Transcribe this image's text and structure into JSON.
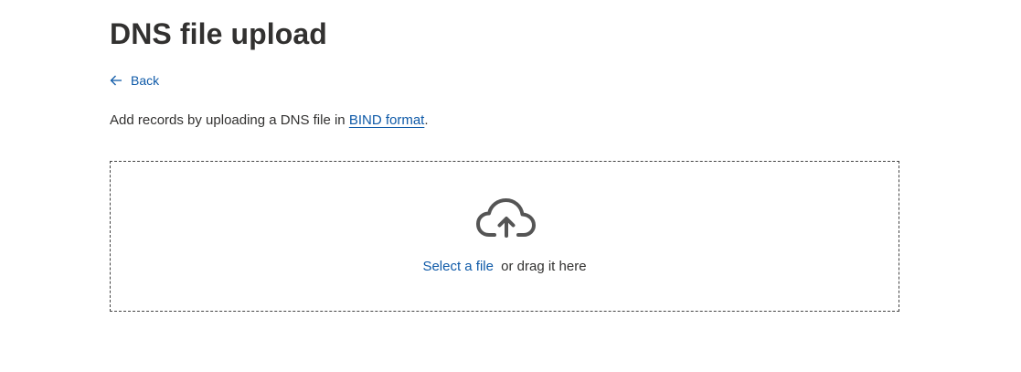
{
  "page": {
    "title": "DNS file upload"
  },
  "back": {
    "label": "Back",
    "icon": "arrow-left-icon"
  },
  "description": {
    "prefix": "Add records by uploading a DNS file in ",
    "link_text": "BIND format",
    "suffix": "."
  },
  "dropzone": {
    "icon": "cloud-upload-icon",
    "select_label": "Select a file",
    "drag_label": "or drag it here"
  },
  "colors": {
    "link": "#0f5aa8",
    "text": "#323130",
    "border": "#444444"
  }
}
